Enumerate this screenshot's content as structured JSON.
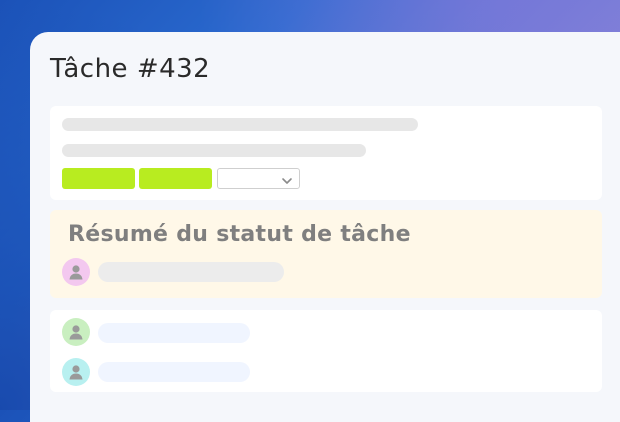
{
  "task": {
    "title": "Tâche #432"
  },
  "summary": {
    "title": "Résumé du statut de tâche"
  },
  "icons": {
    "select": "chevron-down-icon",
    "avatar": "user-icon"
  },
  "colors": {
    "tag": "#b8ec20",
    "avatar_pink": "#f3c8ef",
    "avatar_green": "#c9efc0",
    "avatar_cyan": "#b8f0f0",
    "summary_bg": "#fff8e8"
  }
}
